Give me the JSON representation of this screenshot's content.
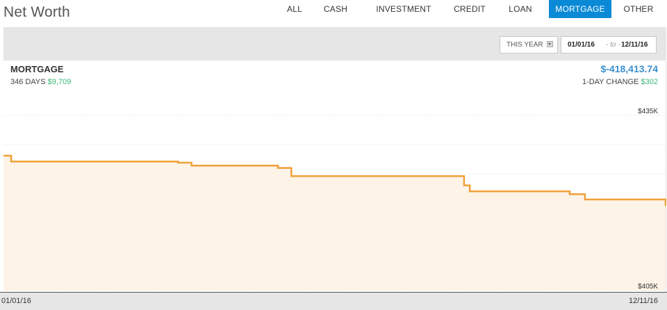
{
  "header": {
    "title": "Net Worth",
    "tabs": [
      {
        "label": "ALL",
        "active": false
      },
      {
        "label": "CASH",
        "active": false
      },
      {
        "label": "INVESTMENT",
        "active": false
      },
      {
        "label": "CREDIT",
        "active": false
      },
      {
        "label": "LOAN",
        "active": false
      },
      {
        "label": "MORTGAGE",
        "active": true
      },
      {
        "label": "OTHER",
        "active": false
      }
    ]
  },
  "toolbar": {
    "range_select": "THIS YEAR",
    "date_from": "01/01/16",
    "date_separator": "- to -",
    "date_to": "12/11/16"
  },
  "account": {
    "name": "MORTGAGE",
    "days_label": "346 DAYS",
    "days_change": "$9,709",
    "balance": "$-418,413.74",
    "day_change_label": "1-DAY CHANGE",
    "day_change_value": "$302"
  },
  "chart_data": {
    "type": "area",
    "ylim": [
      405000,
      435000
    ],
    "y_tick_labels": [
      "$435K",
      "$405K"
    ],
    "x_tick_labels": [
      "01/01/16",
      "12/11/16"
    ],
    "grid": true,
    "x": [
      "01/01/16",
      "01/05/16",
      "04/01/16",
      "04/08/16",
      "05/23/16",
      "05/30/16",
      "08/28/16",
      "08/31/16",
      "10/22/16",
      "10/30/16",
      "12/11/16"
    ],
    "values": [
      428100,
      427100,
      426900,
      426400,
      426000,
      424600,
      423000,
      422000,
      421500,
      420600,
      419500
    ],
    "line_color": "#f0a038",
    "fill_color": "#fdf3e6"
  },
  "footer": {
    "start_date": "01/01/16",
    "end_date": "12/11/16"
  },
  "colors": {
    "accent": "#0a8ad6",
    "positive": "#3cb878",
    "balance": "#3b8fd0"
  }
}
